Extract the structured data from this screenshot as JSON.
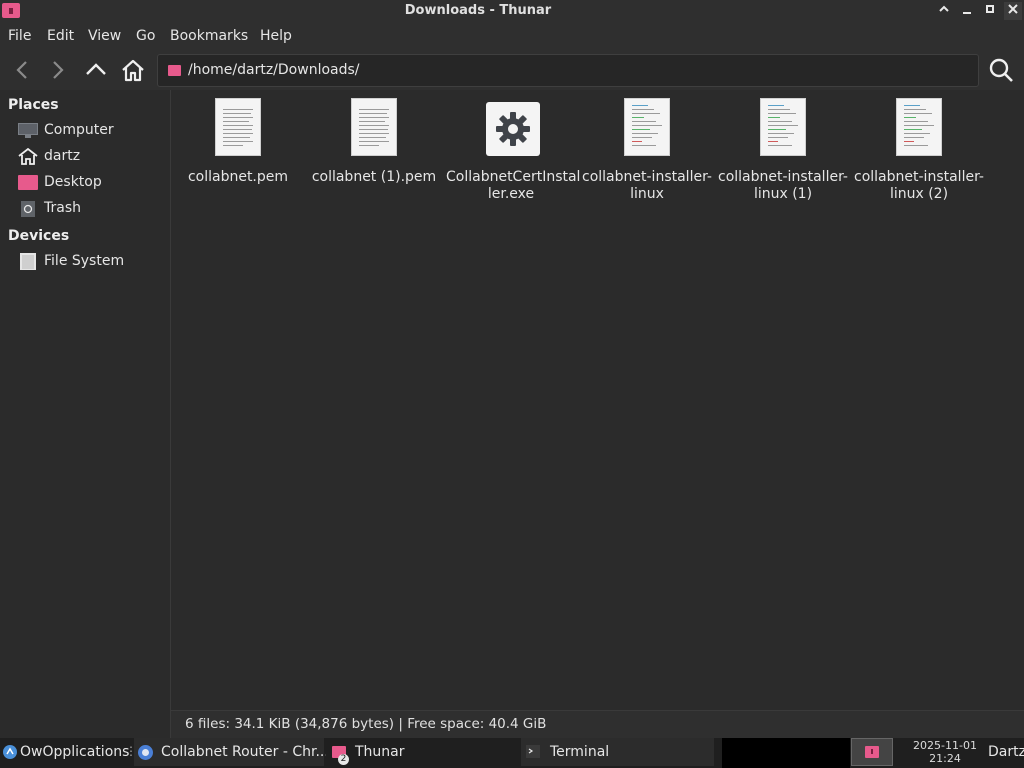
{
  "window": {
    "title": "Downloads - Thunar"
  },
  "menu": [
    "File",
    "Edit",
    "View",
    "Go",
    "Bookmarks",
    "Help"
  ],
  "location": {
    "path": "/home/dartz/Downloads/"
  },
  "sidebar": {
    "places_header": "Places",
    "places": [
      {
        "label": "Computer",
        "icon": "computer-icon"
      },
      {
        "label": "dartz",
        "icon": "home-icon"
      },
      {
        "label": "Desktop",
        "icon": "desktop-folder-icon"
      },
      {
        "label": "Trash",
        "icon": "trash-icon"
      }
    ],
    "devices_header": "Devices",
    "devices": [
      {
        "label": "File System",
        "icon": "drive-icon"
      }
    ]
  },
  "files": [
    {
      "name_line1": "collabnet.pem",
      "name_line2": "",
      "type": "text"
    },
    {
      "name_line1": "collabnet (1).pem",
      "name_line2": "",
      "type": "text"
    },
    {
      "name_line1": "CollabnetCertInstal",
      "name_line2": "ler.exe",
      "type": "executable"
    },
    {
      "name_line1": "collabnet-installer-",
      "name_line2": "linux",
      "type": "script"
    },
    {
      "name_line1": "collabnet-installer-",
      "name_line2": "linux (1)",
      "type": "script"
    },
    {
      "name_line1": "collabnet-installer-",
      "name_line2": "linux (2)",
      "type": "script"
    }
  ],
  "status": {
    "text": "6 files: 34.1 KiB (34,876 bytes)  |  Free space: 40.4 GiB"
  },
  "taskbar": {
    "start_label": "OwOpplications",
    "tasks": [
      {
        "label": "Collabnet Router - Chr...",
        "icon": "chrome-icon"
      },
      {
        "label": "Thunar",
        "icon": "folder-icon",
        "badge": "2"
      },
      {
        "label": "Terminal",
        "icon": "terminal-icon"
      }
    ],
    "date": "2025-11-01",
    "time": "21:24",
    "user": "Dartz"
  },
  "colors": {
    "accent": "#e75a8c",
    "background": "#2b2b2b"
  }
}
